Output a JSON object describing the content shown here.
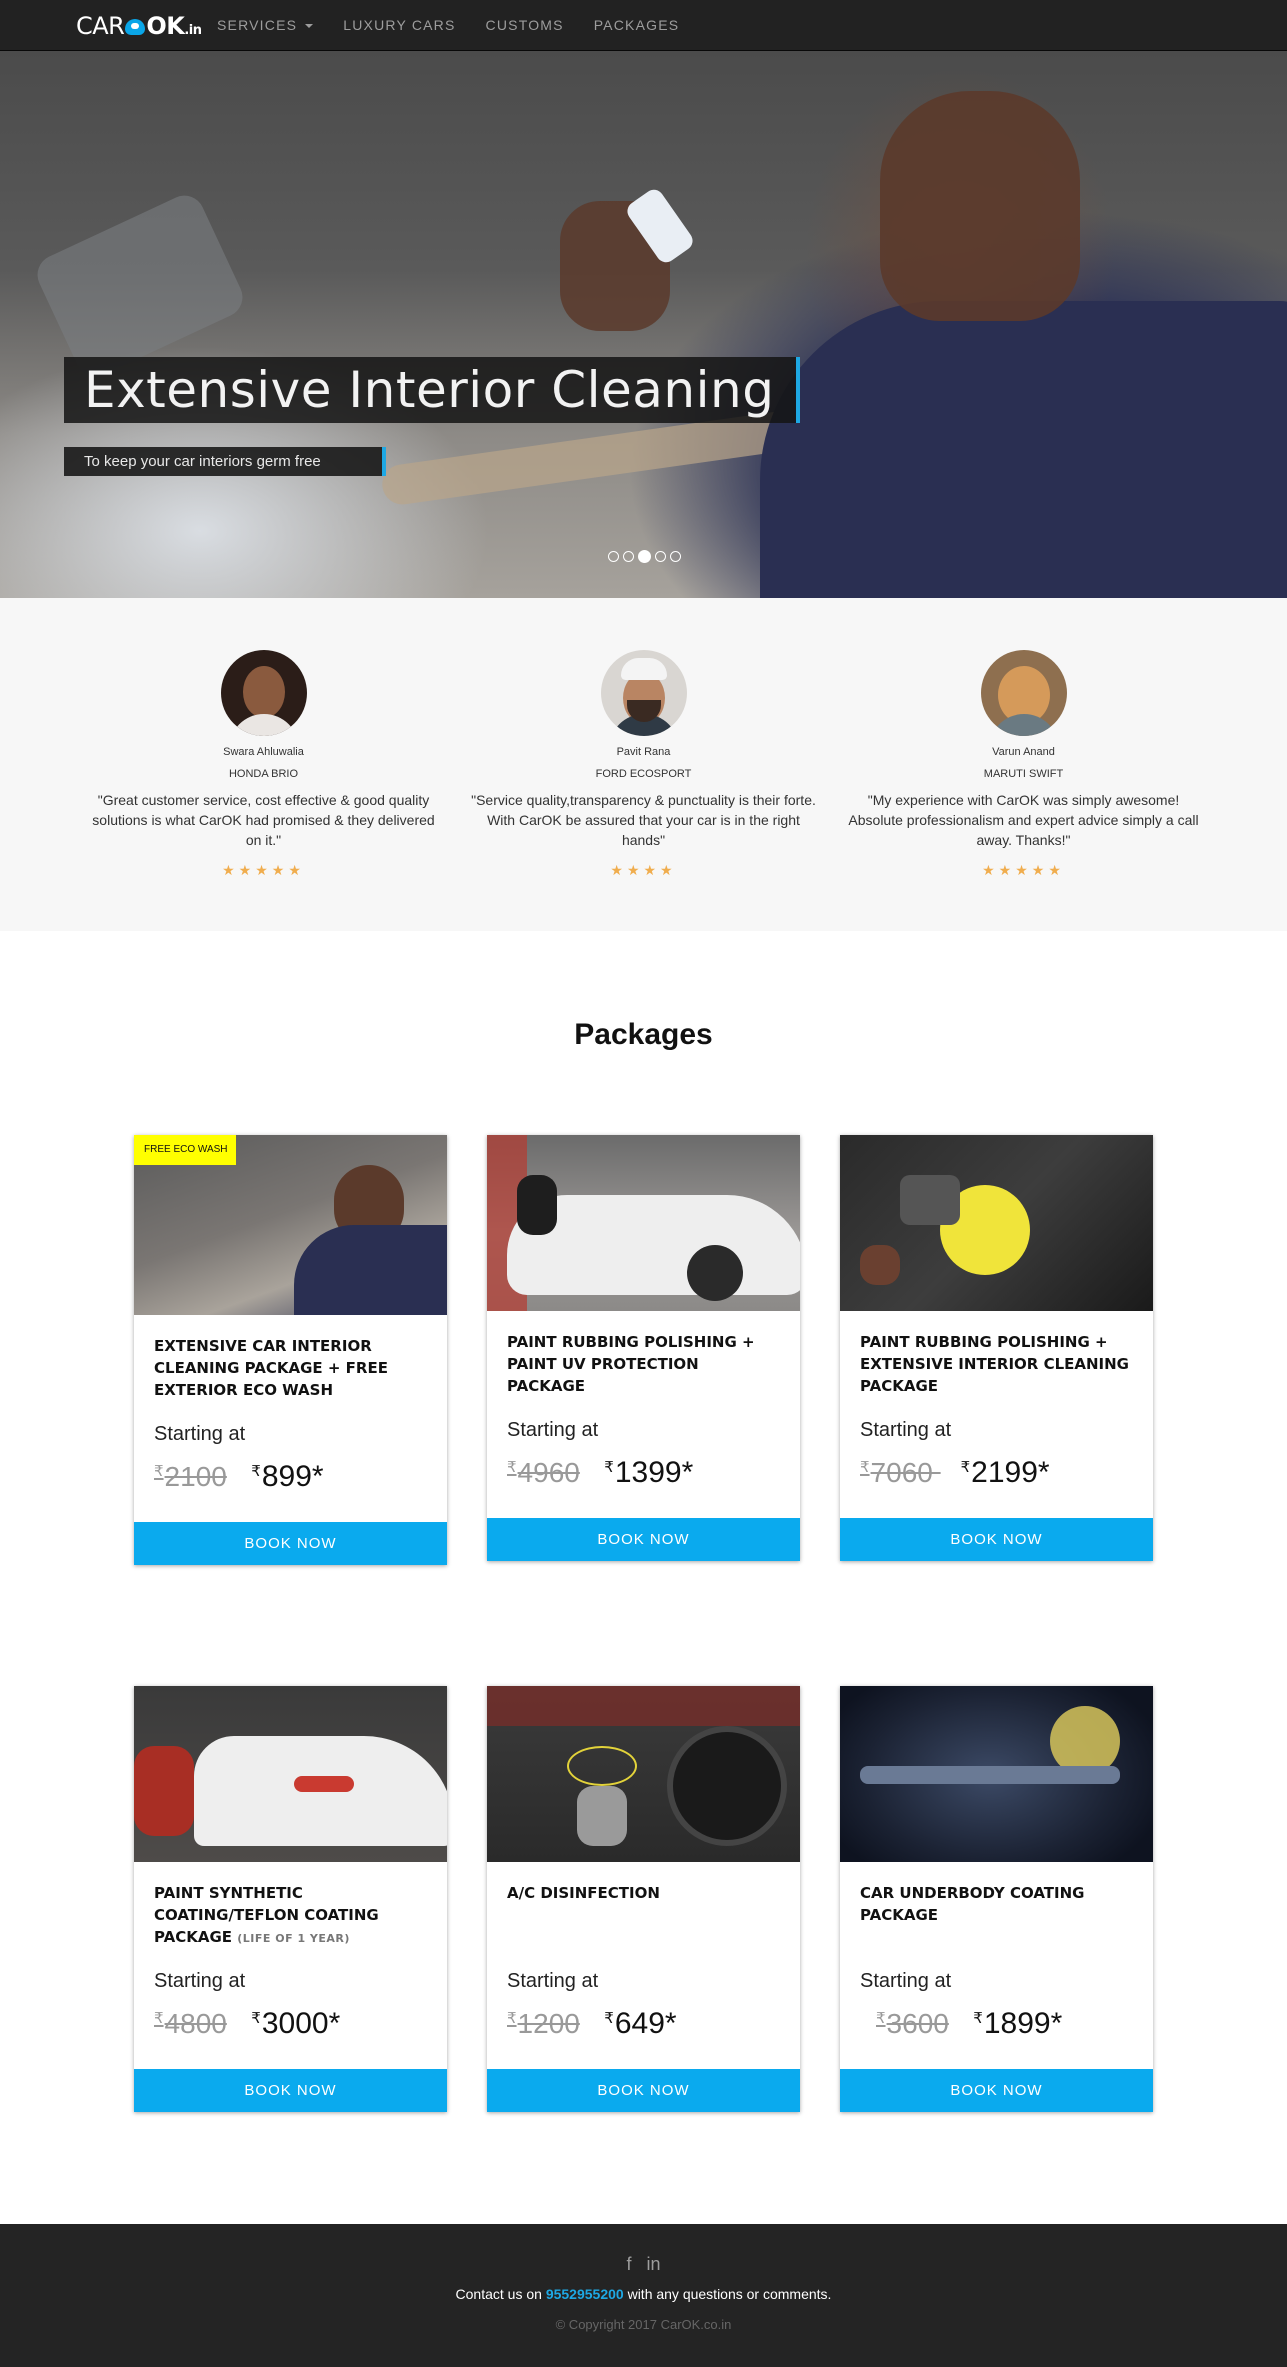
{
  "navbar": {
    "brand_car": "CAR",
    "brand_ok": "OK",
    "brand_in": ".in",
    "items": [
      "SERVICES",
      "LUXURY CARS",
      "CUSTOMS",
      "PACKAGES"
    ]
  },
  "hero": {
    "title": "Extensive Interior Cleaning",
    "subtitle": "To keep your car interiors germ free",
    "slide_count": 5,
    "active_slide": 3
  },
  "testimonials": [
    {
      "name": "Swara Ahluwalia",
      "car": "HONDA BRIO",
      "quote": "\"Great customer service, cost effective & good quality solutions is what CarOK had promised & they delivered on it.\"",
      "stars": "★★★★★"
    },
    {
      "name": "Pavit Rana",
      "car": "FORD ECOSPORT",
      "quote": "\"Service quality,transparency & punctuality is their forte. With CarOK be assured that your car is in the right hands\"",
      "stars": "★★★★"
    },
    {
      "name": "Varun Anand",
      "car": "MARUTI SWIFT",
      "quote": "\"My experience with CarOK was simply awesome! Absolute professionalism and expert advice simply a call away. Thanks!\"",
      "stars": "★★★★★"
    }
  ],
  "packages": {
    "heading": "Packages",
    "currency_symbol": "₹",
    "starting_label": "Starting at",
    "book_label": "BOOK NOW",
    "items": [
      {
        "badge": "FREE ECO WASH",
        "title": "EXTENSIVE CAR INTERIOR CLEANING PACKAGE + FREE EXTERIOR ECO WASH",
        "note": "",
        "old_price": "2100",
        "new_price": "899*"
      },
      {
        "badge": "",
        "title": "PAINT RUBBING POLISHING + PAINT UV PROTECTION PACKAGE",
        "note": "",
        "old_price": "4960",
        "new_price": "1399*"
      },
      {
        "badge": "",
        "title": "PAINT RUBBING POLISHING + EXTENSIVE INTERIOR CLEANING PACKAGE",
        "note": "",
        "old_price": "7060 ",
        "new_price": "2199*"
      },
      {
        "badge": "",
        "title": "PAINT SYNTHETIC COATING/TEFLON COATING PACKAGE",
        "note": "(LIFE OF 1 YEAR)",
        "old_price": "4800",
        "new_price": "3000*"
      },
      {
        "badge": "",
        "title": "A/C DISINFECTION",
        "note": "",
        "old_price": "1200",
        "new_price": "649*"
      },
      {
        "badge": "",
        "title": "CAR UNDERBODY COATING PACKAGE",
        "note": "",
        "old_price": "3600",
        "new_price": "1899*"
      }
    ]
  },
  "footer": {
    "facebook_icon": "f",
    "linkedin_icon": "in",
    "contact_prefix": "Contact us on ",
    "phone": "9552955200",
    "contact_suffix": " with any questions or comments.",
    "copyright": "© Copyright 2017 CarOK.co.in"
  }
}
